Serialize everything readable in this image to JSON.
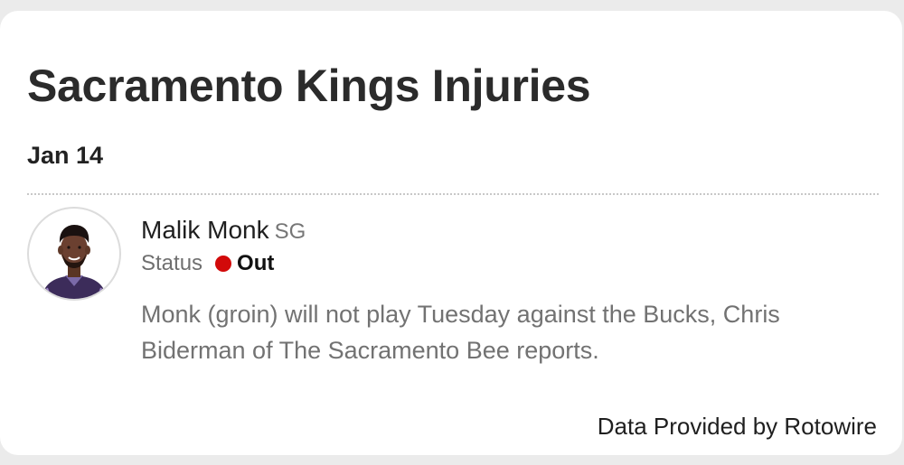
{
  "header": {
    "title": "Sacramento Kings Injuries"
  },
  "injury": {
    "date": "Jan 14",
    "player": {
      "name": "Malik Monk",
      "position": "SG",
      "avatar_icon": "player-headshot-icon"
    },
    "status": {
      "label": "Status",
      "value": "Out",
      "indicator_color": "#d20a0a"
    },
    "note": "Monk (groin) will not play Tuesday against the Bucks, Chris Biderman of The Sacramento Bee reports."
  },
  "footer": {
    "credit": "Data Provided by Rotowire"
  }
}
